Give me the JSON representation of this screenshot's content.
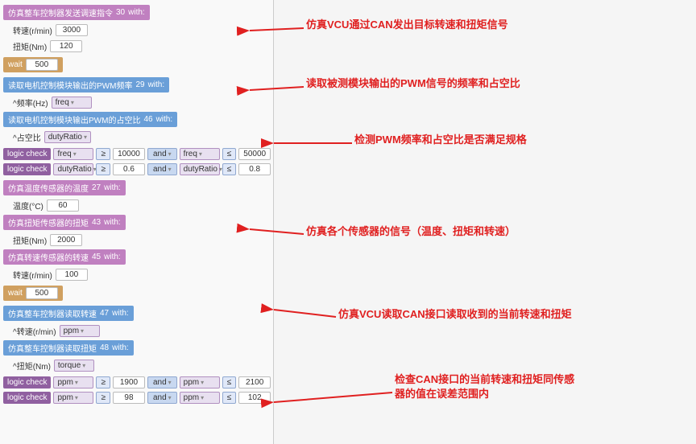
{
  "left": {
    "blocks": [
      {
        "id": "send-cmd",
        "type": "header-purple",
        "label": "仿真整车控制器发送调速指令",
        "number": "30",
        "prefix": "with:",
        "children": [
          {
            "id": "rpm",
            "field": "转速(r/min)",
            "value": "3000"
          },
          {
            "id": "torque",
            "field": "扭矩(Nm)",
            "value": "120"
          }
        ]
      },
      {
        "id": "wait1",
        "type": "wait",
        "label": "wait",
        "value": "500"
      },
      {
        "id": "read-freq",
        "type": "header-blue",
        "label": "读取电机控制模块输出的PWM频率",
        "number": "29",
        "prefix": "with:",
        "children": [
          {
            "id": "freq-var",
            "field": "^频率(Hz)",
            "dropdown": "freq"
          }
        ]
      },
      {
        "id": "read-duty",
        "type": "header-blue",
        "label": "读取电机控制模块输出PWM的占空比",
        "number": "46",
        "prefix": "with:",
        "children": [
          {
            "id": "duty-var",
            "field": "^占空比",
            "dropdown": "dutyRatio"
          }
        ]
      },
      {
        "id": "logic1",
        "type": "logic",
        "label": "logic check",
        "conditions": [
          {
            "var": "freq",
            "op": "≥",
            "val": "10000",
            "and": "and",
            "var2": "freq",
            "op2": "≤",
            "val2": "50000"
          }
        ]
      },
      {
        "id": "logic2",
        "type": "logic",
        "label": "logic check",
        "conditions": [
          {
            "var": "dutyRatio",
            "op": "≥",
            "val": "0.6",
            "and": "and",
            "var2": "dutyRatio",
            "op2": "≤",
            "val2": "0.8"
          }
        ]
      },
      {
        "id": "sim-temp",
        "type": "header-purple",
        "label": "仿真温度传感器的温度",
        "number": "27",
        "prefix": "with:",
        "children": [
          {
            "id": "temp-val",
            "field": "温度(°C)",
            "value": "60"
          }
        ]
      },
      {
        "id": "sim-torque",
        "type": "header-purple",
        "label": "仿真扭矩传感器的扭矩",
        "number": "43",
        "prefix": "with:",
        "children": [
          {
            "id": "torque-val",
            "field": "扭矩(Nm)",
            "value": "2000"
          }
        ]
      },
      {
        "id": "sim-speed",
        "type": "header-purple",
        "label": "仿真转速传感器的转速",
        "number": "45",
        "prefix": "with:",
        "children": [
          {
            "id": "speed-val",
            "field": "转速(r/min)",
            "value": "100"
          }
        ]
      },
      {
        "id": "wait2",
        "type": "wait",
        "label": "wait",
        "value": "500"
      },
      {
        "id": "read-rpm",
        "type": "header-blue",
        "label": "仿真整车控制器读取转速",
        "number": "47",
        "prefix": "with:",
        "children": [
          {
            "id": "rpm-var",
            "field": "^转速(r/min)",
            "dropdown": "ppm"
          }
        ]
      },
      {
        "id": "read-torque",
        "type": "header-blue",
        "label": "仿真整车控制器读取扭矩",
        "number": "48",
        "prefix": "with:",
        "children": [
          {
            "id": "torque-var2",
            "field": "^扭矩(Nm)",
            "dropdown": "torque"
          }
        ]
      },
      {
        "id": "logic3",
        "type": "logic",
        "label": "logic check",
        "conditions": [
          {
            "var": "ppm",
            "op": "≥",
            "val": "1900",
            "and": "and",
            "var2": "ppm",
            "op2": "≤",
            "val2": "2100"
          }
        ]
      },
      {
        "id": "logic4",
        "type": "logic",
        "label": "logic check",
        "conditions": [
          {
            "var": "ppm",
            "op": "≥",
            "val": "98",
            "and": "and",
            "var2": "ppm",
            "op2": "≤",
            "val2": "102"
          }
        ]
      }
    ]
  },
  "annotations": [
    {
      "id": "ann1",
      "text": "仿真VCU通过CAN发出目标转速和扭矩信号",
      "position": "top-right"
    },
    {
      "id": "ann2",
      "text": "读取被测模块输出的PWM信号的频率和占空比",
      "position": "mid-right"
    },
    {
      "id": "ann3",
      "text": "检测PWM频率和占空比是否满足规格",
      "position": "logic-right"
    },
    {
      "id": "ann4",
      "text": "仿真各个传感器的信号（温度、扭矩和转速）",
      "position": "sensor-right"
    },
    {
      "id": "ann5",
      "text": "仿真VCU读取CAN接口读取收到的当前转速和扭矩",
      "position": "bottom-mid-right"
    },
    {
      "id": "ann6",
      "text1": "检查CAN接口的当前转速和扭矩同传感",
      "text2": "器的值在误差范围内",
      "position": "bottom-right"
    }
  ]
}
